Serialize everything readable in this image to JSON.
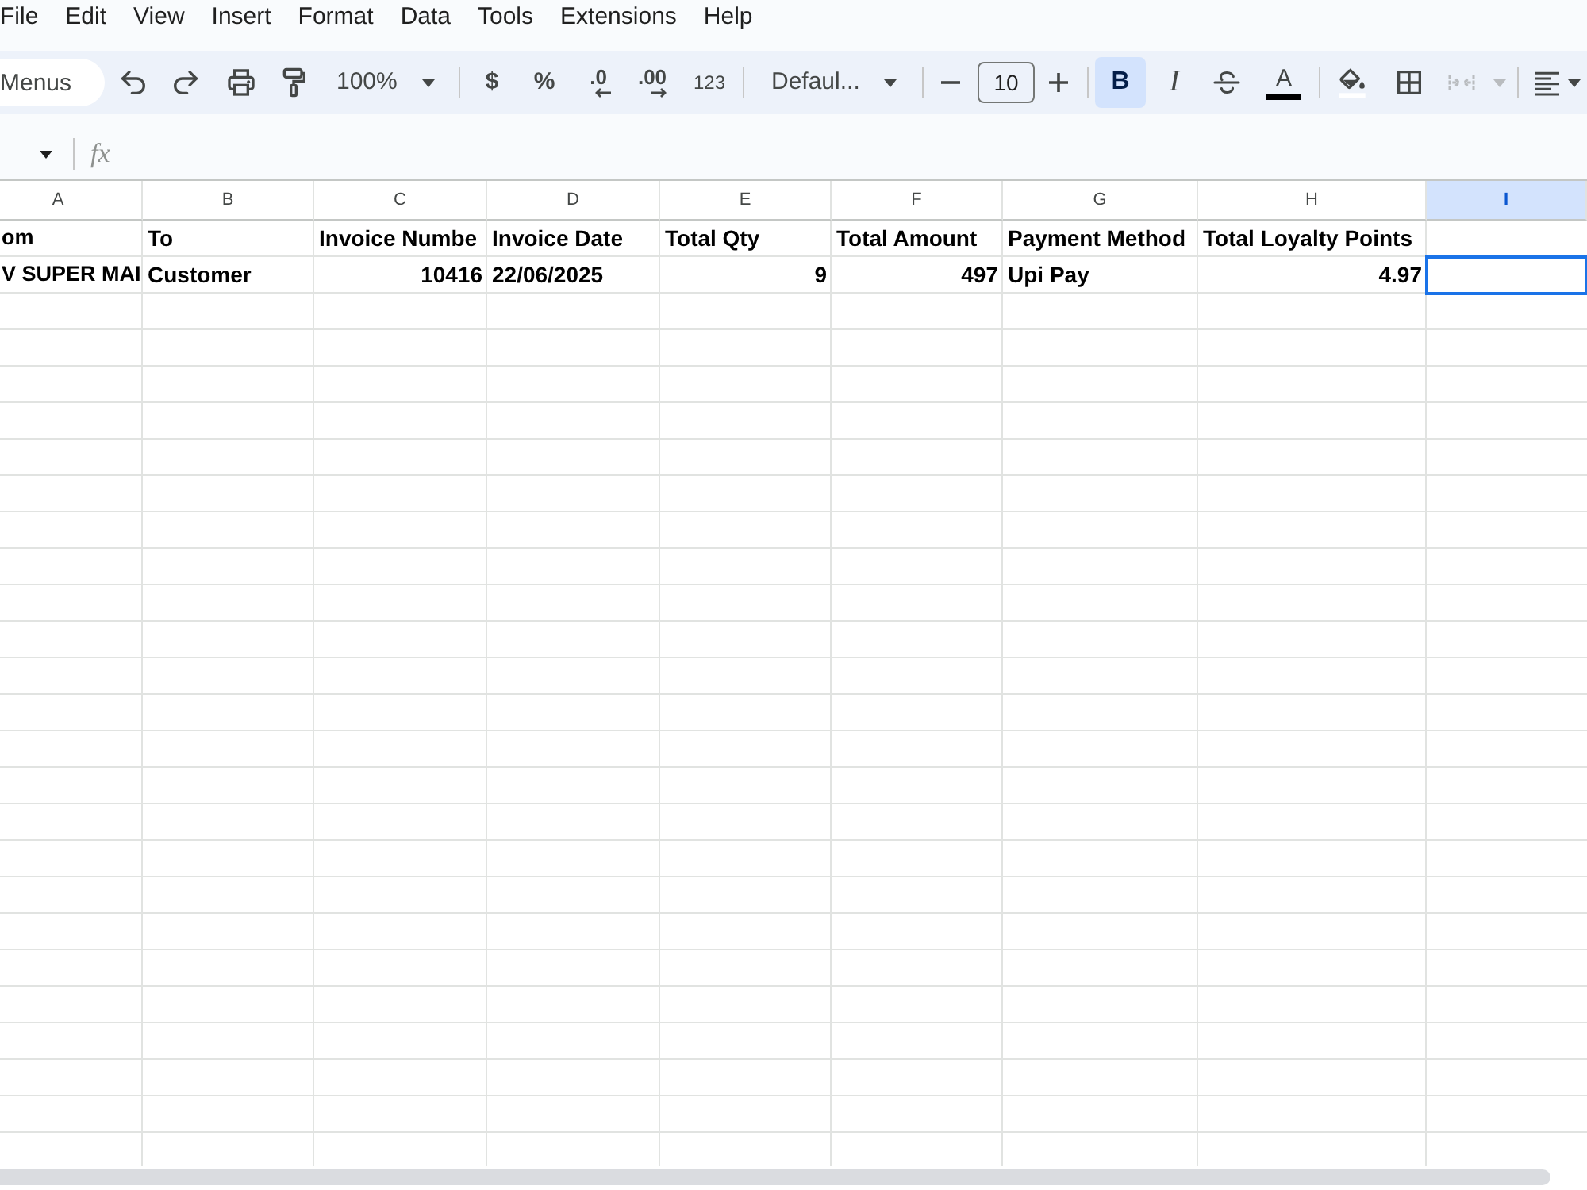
{
  "menu_bar": {
    "items": [
      "File",
      "Edit",
      "View",
      "Insert",
      "Format",
      "Data",
      "Tools",
      "Extensions",
      "Help"
    ]
  },
  "toolbar": {
    "search": {
      "placeholder": "Menus"
    },
    "zoom": "100%",
    "number_formats": [
      {
        "kind": "currency",
        "label": "$"
      },
      {
        "kind": "percent",
        "label": "%"
      },
      {
        "kind": "decrease_decimals",
        "label": ".0"
      },
      {
        "kind": "increase_decimals",
        "label": ".00"
      },
      {
        "kind": "more_formats",
        "label": "123"
      }
    ],
    "font": "Defaul...",
    "font_size": "10",
    "styles": [
      {
        "kind": "bold",
        "label": "B",
        "on": true
      },
      {
        "kind": "italic",
        "label": "I",
        "on": false
      }
    ],
    "text_color": {
      "label": "A"
    },
    "merge": {
      "disabled": true
    }
  },
  "formula_bar": {
    "label": "fx"
  },
  "grid": {
    "columns": [
      {
        "label": "A",
        "selected": false
      },
      {
        "label": "B",
        "selected": false
      },
      {
        "label": "C",
        "selected": false
      },
      {
        "label": "D",
        "selected": false
      },
      {
        "label": "E",
        "selected": false
      },
      {
        "label": "F",
        "selected": false
      },
      {
        "label": "G",
        "selected": false
      },
      {
        "label": "H",
        "selected": false
      },
      {
        "label": "I",
        "selected": true
      }
    ],
    "rows": [
      {
        "selected": false,
        "cells": [
          {
            "kind": "text",
            "text": "om"
          },
          {
            "kind": "text",
            "text": "To"
          },
          {
            "kind": "text",
            "text": "Invoice Numbe"
          },
          {
            "kind": "text",
            "text": "Invoice Date"
          },
          {
            "kind": "text",
            "text": "Total Qty"
          },
          {
            "kind": "text",
            "text": "Total Amount"
          },
          {
            "kind": "text",
            "text": "Payment Method"
          },
          {
            "kind": "text",
            "text": "Total Loyalty Points"
          }
        ]
      },
      {
        "selected": true,
        "cells": [
          {
            "kind": "text",
            "text": "V SUPER MAI"
          },
          {
            "kind": "text",
            "text": "Customer"
          },
          {
            "kind": "number",
            "text": "10416"
          },
          {
            "kind": "text",
            "text": "22/06/2025"
          },
          {
            "kind": "number",
            "text": "9"
          },
          {
            "kind": "number",
            "text": "497"
          },
          {
            "kind": "text",
            "text": "Upi Pay"
          },
          {
            "kind": "number",
            "text": "4.97"
          }
        ]
      }
    ]
  }
}
